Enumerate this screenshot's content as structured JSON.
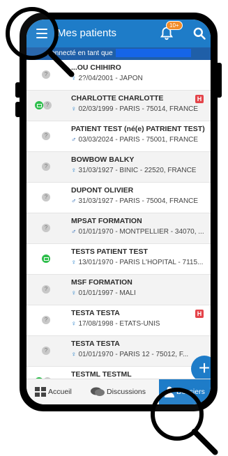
{
  "header": {
    "title": "Mes patients",
    "notif_badge": "10+"
  },
  "banner": {
    "prefix": "Connecté en tant que"
  },
  "patients": [
    {
      "name": "...OU CHIHIRO",
      "gender": "f",
      "info": "2?/04/2001 - JAPON",
      "status": [
        "q"
      ],
      "hospital": false
    },
    {
      "name": "CHARLOTTE CHARLOTTE",
      "gender": "f",
      "info": "02/03/1999 - PARIS - 75014, FRANCE",
      "status": [
        "m",
        "q"
      ],
      "hospital": true
    },
    {
      "name": "PATIENT TEST (né(e) PATRIENT TEST)",
      "gender": "m",
      "info": "03/03/2024 - PARIS - 75001, FRANCE",
      "status": [
        "q"
      ],
      "hospital": false
    },
    {
      "name": "BOWBOW BALKY",
      "gender": "f",
      "info": "31/03/1927 - BINIC - 22520, FRANCE",
      "status": [
        "q"
      ],
      "hospital": false
    },
    {
      "name": "DUPONT OLIVIER",
      "gender": "m",
      "info": "31/03/1927 - PARIS - 75004, FRANCE",
      "status": [
        "q"
      ],
      "hospital": false
    },
    {
      "name": "MPSAT FORMATION",
      "gender": "m",
      "info": "01/01/1970 - MONTPELLIER - 34070, ...",
      "status": [
        "q"
      ],
      "hospital": false
    },
    {
      "name": "TESTS PATIENT TEST",
      "gender": "f",
      "info": "13/01/1970 - PARIS L'HOPITAL - 7115...",
      "status": [
        "m"
      ],
      "hospital": false
    },
    {
      "name": "MSF FORMATION",
      "gender": "f",
      "info": "01/01/1997 - MALI",
      "status": [
        "q"
      ],
      "hospital": false
    },
    {
      "name": "TESTA TESTA",
      "gender": "f",
      "info": "17/08/1998 - ETATS-UNIS",
      "status": [
        "q"
      ],
      "hospital": true
    },
    {
      "name": "TESTA TESTA",
      "gender": "f",
      "info": "01/01/1970 - PARIS 12 - 75012, F...",
      "status": [
        "q"
      ],
      "hospital": false
    },
    {
      "name": "TESTML TESTML",
      "gender": "f",
      "info": "",
      "status": [
        "m",
        "q"
      ],
      "hospital": false
    }
  ],
  "glyphs": {
    "female": "♀",
    "male": "♂",
    "hospital": "H",
    "fab": "+"
  },
  "tabs": [
    {
      "label": "Accueil",
      "icon": "grid-icon"
    },
    {
      "label": "Discussions",
      "icon": "chat-icon"
    },
    {
      "label": "Dossiers",
      "icon": "person-icon",
      "active": true
    }
  ],
  "colors": {
    "primary": "#1E7CC8",
    "banner": "#1F5FA8",
    "badge": "#F28C28",
    "online": "#2DBE4B",
    "hospital": "#E4444A"
  }
}
